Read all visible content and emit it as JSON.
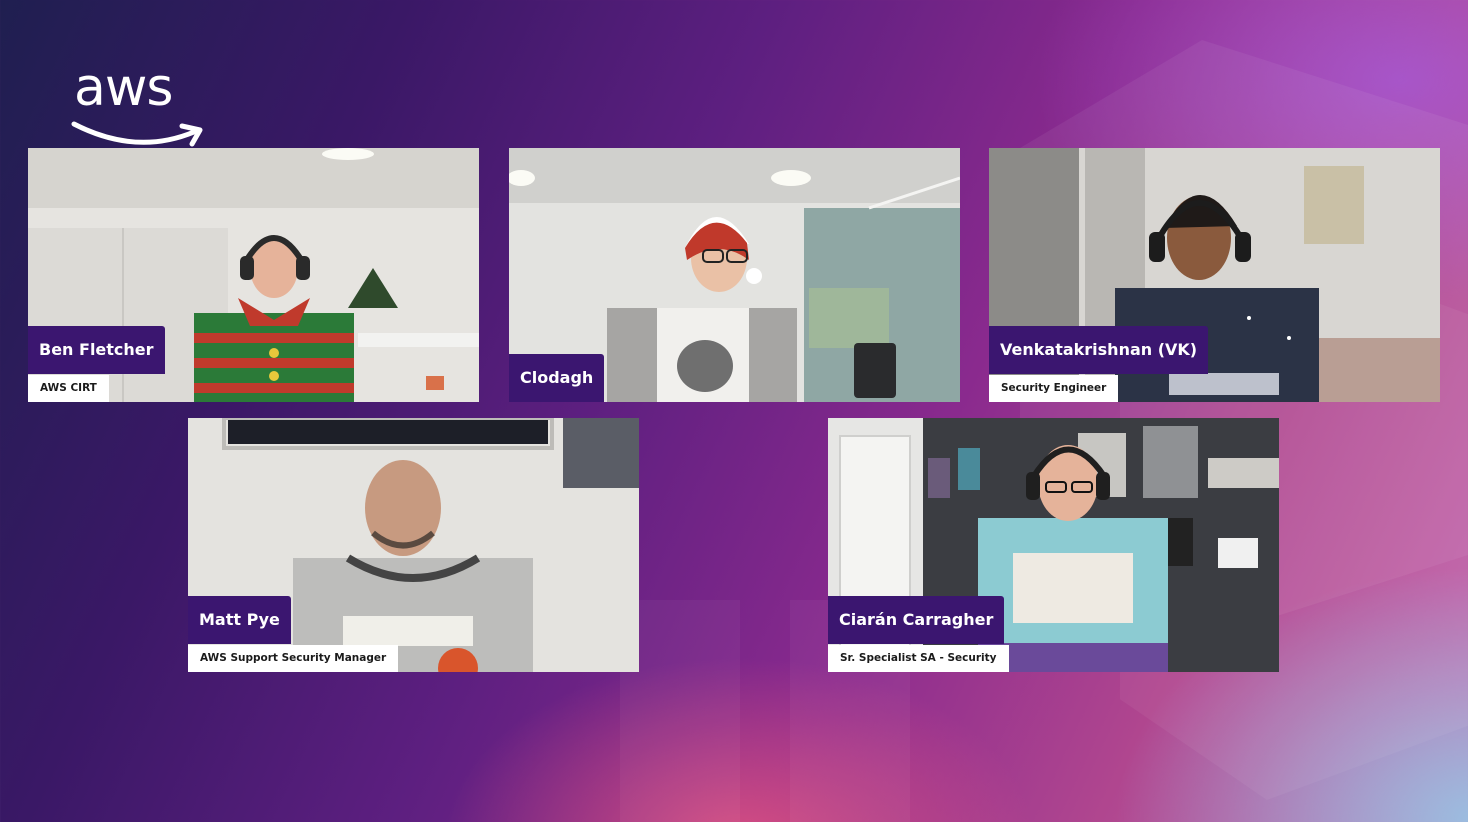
{
  "brand": {
    "logo_text": "aws",
    "logo_icon": "aws-smile-arrow-icon"
  },
  "participants": [
    {
      "name": "Ben Fletcher",
      "title": "AWS CIRT"
    },
    {
      "name": "Clodagh",
      "title": ""
    },
    {
      "name": "Venkatakrishnan (VK)",
      "title": "Security Engineer"
    },
    {
      "name": "Matt Pye",
      "title": "AWS Support Security Manager"
    },
    {
      "name": "Ciarán Carragher",
      "title": "Sr. Specialist SA - Security"
    }
  ],
  "colors": {
    "name_tag_bg": "#3b1670",
    "title_tag_bg": "#ffffff",
    "background_start": "#1f1f50",
    "background_end": "#c46ab0"
  }
}
